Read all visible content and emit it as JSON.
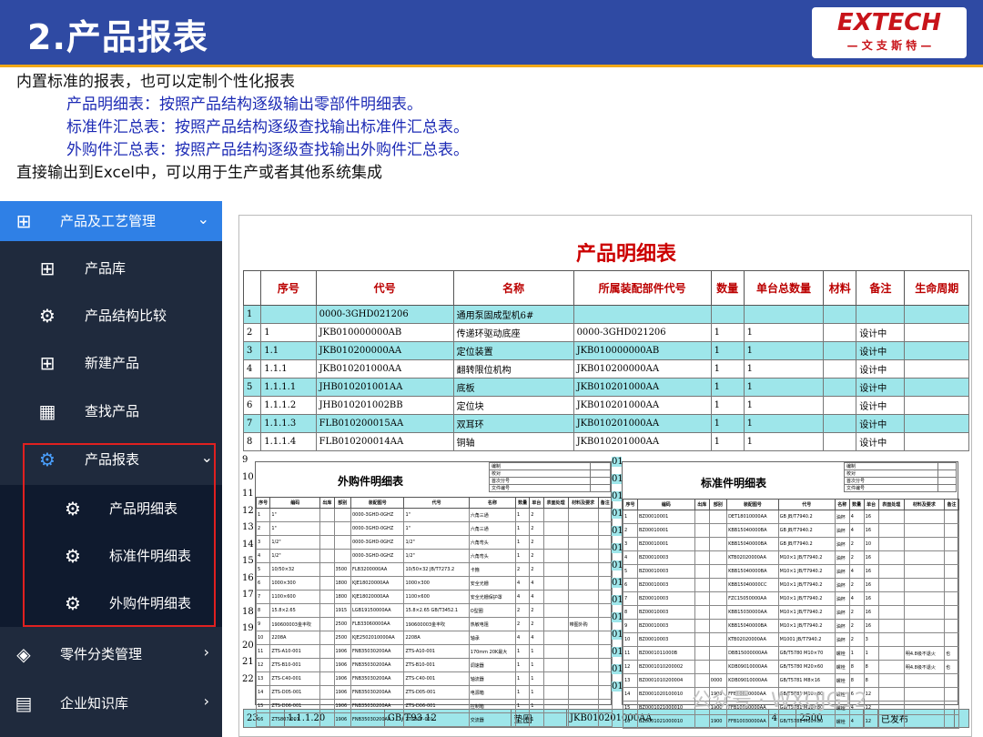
{
  "header": {
    "title": "2.产品报表",
    "logo_text": "EXTECH",
    "logo_sub": "— 文 支 斯 特 —"
  },
  "intro": {
    "line1": "内置标准的报表，也可以定制个性化报表",
    "line2": "产品明细表：按照产品结构逐级输出零部件明细表。",
    "line3": "标准件汇总表：按照产品结构逐级查找输出标准件汇总表。",
    "line4": "外购件汇总表：按照产品结构逐级查找输出外购件汇总表。",
    "line5": "直接输出到Excel中，可以用于生产或者其他系统集成"
  },
  "sidebar": {
    "top": "产品及工艺管理",
    "items": [
      "产品库",
      "产品结构比较",
      "新建产品",
      "查找产品",
      "产品报表"
    ],
    "subitems": [
      "产品明细表",
      "标准件明细表",
      "外购件明细表"
    ],
    "bottom": [
      "零件分类管理",
      "企业知识库"
    ]
  },
  "report": {
    "title": "产品明细表",
    "headers": [
      "序号",
      "代号",
      "名称",
      "所属装配部件代号",
      "数量",
      "单台总数量",
      "材料",
      "备注",
      "生命周期"
    ],
    "rows": [
      [
        "1",
        "",
        "0000-3GHD021206",
        "通用泵固成型机6#",
        "",
        "",
        "",
        "",
        ""
      ],
      [
        "2",
        "1",
        "JKB010000000AB",
        "传递环驱动底座",
        "0000-3GHD021206",
        "1",
        "1",
        "",
        "设计中"
      ],
      [
        "3",
        "1.1",
        "JKB010200000AA",
        "定位装置",
        "JKB010000000AB",
        "1",
        "1",
        "",
        "设计中"
      ],
      [
        "4",
        "1.1.1",
        "JKB010201000AA",
        "翻转限位机构",
        "JKB010200000AA",
        "1",
        "1",
        "",
        "设计中"
      ],
      [
        "5",
        "1.1.1.1",
        "JHB010201001AA",
        "底板",
        "JKB010201000AA",
        "1",
        "1",
        "",
        "设计中"
      ],
      [
        "6",
        "1.1.1.2",
        "JHB010201002BB",
        "定位块",
        "JKB010201000AA",
        "1",
        "1",
        "",
        "设计中"
      ],
      [
        "7",
        "1.1.1.3",
        "FLB010200015AA",
        "双耳环",
        "JKB010201000AA",
        "1",
        "1",
        "",
        "设计中"
      ],
      [
        "8",
        "1.1.1.4",
        "FLB010200014AA",
        "铜轴",
        "JKB010201000AA",
        "1",
        "1",
        "",
        "设计中"
      ]
    ],
    "last_row": [
      "23",
      "1.1.1.20",
      "GB/T93 12",
      "垫圈",
      "JKB010201000AA",
      "4",
      "2500",
      "",
      "已发布"
    ],
    "strip": [
      "9",
      "10",
      "11",
      "12",
      "13",
      "14",
      "15",
      "16",
      "17",
      "18",
      "19",
      "20",
      "21",
      "22"
    ]
  },
  "purchase": {
    "title": "外购件明细表",
    "meta": [
      "编制",
      "校对",
      "首次分号",
      "文件编号"
    ],
    "headers": [
      "序号",
      "编码",
      "出库",
      "部别",
      "装配图号",
      "代号",
      "名称",
      "数量",
      "单台",
      "表面处理",
      "材料及要求",
      "备注"
    ],
    "rows": [
      [
        "1",
        "1\"",
        "",
        "",
        "0000-3GHD-0GHZ",
        "1\"",
        "六角三通",
        "1",
        "2",
        "",
        "",
        ""
      ],
      [
        "2",
        "1\"",
        "",
        "",
        "0000-3GHD-0GHZ",
        "1\"",
        "六角三通",
        "1",
        "2",
        "",
        "",
        ""
      ],
      [
        "3",
        "1/2\"",
        "",
        "",
        "0000-3GHD-0GHZ",
        "1/2\"",
        "六角弯头",
        "1",
        "2",
        "",
        "",
        ""
      ],
      [
        "4",
        "1/2\"",
        "",
        "",
        "0000-3GHD-0GHZ",
        "1/2\"",
        "六角弯头",
        "1",
        "2",
        "",
        "",
        ""
      ],
      [
        "5",
        "10/50×32",
        "",
        "3500",
        "FLB3200000AA",
        "10/50×32 JB/T7273.2",
        "卡箍",
        "2",
        "2",
        "",
        "",
        ""
      ],
      [
        "6",
        "1000×300",
        "",
        "1800",
        "KJE18020000AA",
        "1000×300",
        "安全光栅",
        "4",
        "4",
        "",
        "",
        ""
      ],
      [
        "7",
        "1100×600",
        "",
        "1800",
        "KJE18020000AA",
        "1100×600",
        "安全光栅保护罩",
        "4",
        "4",
        "",
        "",
        ""
      ],
      [
        "8",
        "15.8×2.65",
        "",
        "1915",
        "LGB19150000AA",
        "15.8×2.65 GB/T3452.1",
        "O型圈",
        "2",
        "2",
        "",
        "",
        ""
      ],
      [
        "9",
        "190600003金丰吹",
        "",
        "2500",
        "FLB33060000AA",
        "190600003金丰吹",
        "热敏电阻",
        "2",
        "2",
        "",
        "带图外购",
        ""
      ],
      [
        "10",
        "2208A",
        "",
        "2500",
        "KJE2502010000AA",
        "2208A",
        "轴承",
        "4",
        "4",
        "",
        "",
        ""
      ],
      [
        "11",
        "ZTS-A10-001",
        "",
        "1906",
        "FNB35030200AA",
        "ZTS-A10-001",
        "170mm 20K最大",
        "1",
        "1",
        "",
        "",
        ""
      ],
      [
        "12",
        "ZTS-B10-001",
        "",
        "1906",
        "FNB35030200AA",
        "ZTS-B10-001",
        "调速器",
        "1",
        "1",
        "",
        "",
        ""
      ],
      [
        "13",
        "ZTS-C40-001",
        "",
        "1906",
        "FNB35030200AA",
        "ZTS-C40-001",
        "轴流器",
        "1",
        "1",
        "",
        "",
        ""
      ],
      [
        "14",
        "ZTS-D05-001",
        "",
        "1906",
        "FNB35030200AA",
        "ZTS-D05-001",
        "电源箱",
        "1",
        "1",
        "",
        "",
        ""
      ],
      [
        "15",
        "ZTS-D06-001",
        "",
        "1906",
        "FNB35030200AA",
        "ZTS-D06-001",
        "控制箱",
        "1",
        "1",
        "",
        "",
        ""
      ],
      [
        "16",
        "ZTS807-001",
        "",
        "1906",
        "FNB35030200AA",
        "ZTS807-001",
        "交流器",
        "1",
        "1",
        "",
        "",
        ""
      ]
    ]
  },
  "standard": {
    "title": "标准件明细表",
    "meta": [
      "编制",
      "校对",
      "首次分号",
      "文件编号"
    ],
    "headers": [
      "序号",
      "编码",
      "出库",
      "部别",
      "装配图号",
      "代号",
      "名称",
      "数量",
      "单台",
      "表面处理",
      "材料及要求",
      "备注"
    ],
    "rows": [
      [
        "1",
        "BZ00010001",
        "",
        "",
        "DET18010000AA",
        "GB JB/T7940.2",
        "油杯",
        "4",
        "16",
        "",
        "",
        ""
      ],
      [
        "2",
        "BZ00010001",
        "",
        "",
        "KBB15040000BA",
        "GB JB/T7940.2",
        "油杯",
        "4",
        "16",
        "",
        "",
        ""
      ],
      [
        "3",
        "BZ00010001",
        "",
        "",
        "KBB15040000BA",
        "GB JB/T7940.2",
        "油杯",
        "2",
        "10",
        "",
        "",
        ""
      ],
      [
        "4",
        "BZ00010003",
        "",
        "",
        "KTB02020000AA",
        "M10×1 JB/T7940.2",
        "油杯",
        "2",
        "16",
        "",
        "",
        ""
      ],
      [
        "5",
        "BZ00010003",
        "",
        "",
        "KBB15040000BA",
        "M10×1 JB/T7940.2",
        "油杯",
        "4",
        "16",
        "",
        "",
        ""
      ],
      [
        "6",
        "BZ00010003",
        "",
        "",
        "KBB15040000CC",
        "M10×1 JB/T7940.2",
        "油杯",
        "2",
        "16",
        "",
        "",
        ""
      ],
      [
        "7",
        "BZ00010003",
        "",
        "",
        "FZC15050000AA",
        "M10×1 JB/T7940.2",
        "油杯",
        "4",
        "16",
        "",
        "",
        ""
      ],
      [
        "8",
        "BZ00010003",
        "",
        "",
        "KBB15030000AA",
        "M10×1 JB/T7940.2",
        "油杯",
        "2",
        "16",
        "",
        "",
        ""
      ],
      [
        "9",
        "BZ00010003",
        "",
        "",
        "KBB15040000BA",
        "M10×1 JB/T7940.2",
        "油杯",
        "2",
        "16",
        "",
        "",
        ""
      ],
      [
        "10",
        "BZ00010003",
        "",
        "",
        "KTB02020000AA",
        "M1001 JB/T7940.2",
        "油杯",
        "2",
        "3",
        "",
        "",
        ""
      ],
      [
        "11",
        "BZ0001011000B",
        "",
        "",
        "DBB15000000AA",
        "GB/T5780 M10×70",
        "螺栓",
        "1",
        "1",
        "",
        "明4.8级不退火",
        "也"
      ],
      [
        "12",
        "BZ0001010200002",
        "",
        "",
        "KDB09010000AA",
        "GB/T5780 M20×60",
        "螺栓",
        "8",
        "8",
        "",
        "明4.8级不退火",
        "也"
      ],
      [
        "13",
        "BZ0001010200004",
        "",
        "0000",
        "KDB09010000AA",
        "GB/T5781 M8×16",
        "螺栓",
        "8",
        "8",
        "",
        "",
        ""
      ],
      [
        "14",
        "BZ0001020100010",
        "",
        "1900",
        "FFB10020000AA",
        "GB/T5781 M10×80",
        "螺栓",
        "6",
        "12",
        "",
        "",
        ""
      ],
      [
        "15",
        "BZ0001021000010",
        "",
        "1900",
        "FFB10030000AA",
        "GB/T5781 M10×80",
        "螺栓",
        "4",
        "12",
        "",
        "",
        ""
      ],
      [
        "16",
        "BZ0001021000010",
        "",
        "1900",
        "FFB10030000AA",
        "GB/T5781 M10×80",
        "螺栓",
        "4",
        "12",
        "",
        "",
        ""
      ]
    ]
  },
  "overlay_left_strip": [
    "01",
    "01",
    "01",
    "01",
    "01",
    "01",
    "01",
    "01",
    "01",
    "01",
    "01",
    "01",
    "01",
    "01"
  ],
  "watermark": "公众号 · WXQJG12"
}
